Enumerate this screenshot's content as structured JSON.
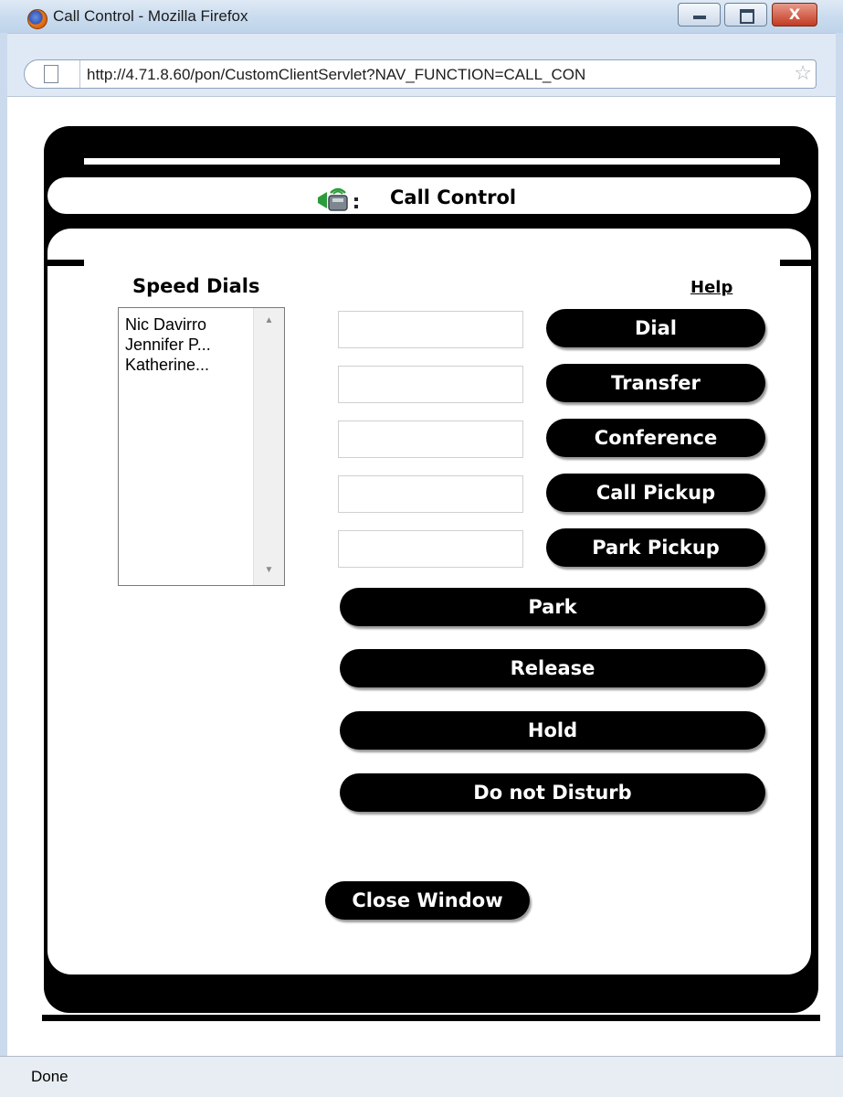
{
  "window": {
    "title": "Call Control - Mozilla Firefox",
    "controls": {
      "close_glyph": "X"
    }
  },
  "navbar": {
    "url": "http://4.71.8.60/pon/CustomClientServlet?NAV_FUNCTION=CALL_CON"
  },
  "dialog": {
    "title": "Call Control",
    "speed_dials": {
      "label": "Speed Dials",
      "items": [
        "Nic Davirro",
        "Jennifer P...",
        "Katherine..."
      ]
    },
    "help_label": "Help",
    "field_buttons": [
      {
        "label": "Dial",
        "input_value": ""
      },
      {
        "label": "Transfer",
        "input_value": ""
      },
      {
        "label": "Conference",
        "input_value": ""
      },
      {
        "label": "Call Pickup",
        "input_value": ""
      },
      {
        "label": "Park Pickup",
        "input_value": ""
      }
    ],
    "wide_buttons": [
      "Park",
      "Release",
      "Hold",
      "Do not Disturb"
    ],
    "close_label": "Close Window"
  },
  "statusbar": {
    "text": "Done"
  }
}
